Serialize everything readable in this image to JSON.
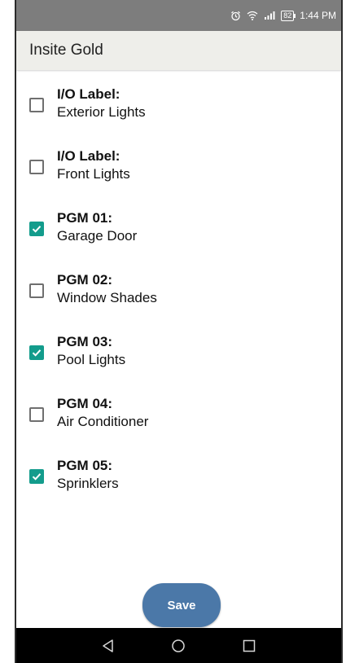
{
  "status_bar": {
    "time": "1:44 PM",
    "battery": "82",
    "icons": [
      "alarm-icon",
      "wifi-icon",
      "signal-icon",
      "battery-icon"
    ]
  },
  "app_bar": {
    "title": "Insite Gold"
  },
  "items": [
    {
      "label": "I/O Label:",
      "value": "Exterior Lights",
      "checked": false
    },
    {
      "label": "I/O Label:",
      "value": "Front Lights",
      "checked": false
    },
    {
      "label": "PGM 01:",
      "value": "Garage Door",
      "checked": true
    },
    {
      "label": "PGM 02:",
      "value": "Window Shades",
      "checked": false
    },
    {
      "label": "PGM 03:",
      "value": "Pool Lights",
      "checked": true
    },
    {
      "label": "PGM 04:",
      "value": "Air Conditioner",
      "checked": false
    },
    {
      "label": "PGM 05:",
      "value": "Sprinklers",
      "checked": true
    }
  ],
  "save_label": "Save",
  "nav_bar": {
    "icons": [
      "back-icon",
      "home-icon",
      "recents-icon"
    ]
  },
  "colors": {
    "accent": "#139c8c",
    "button": "#4b78a8",
    "status_bar": "#7d7d7d",
    "app_bar": "#eeeeea"
  }
}
